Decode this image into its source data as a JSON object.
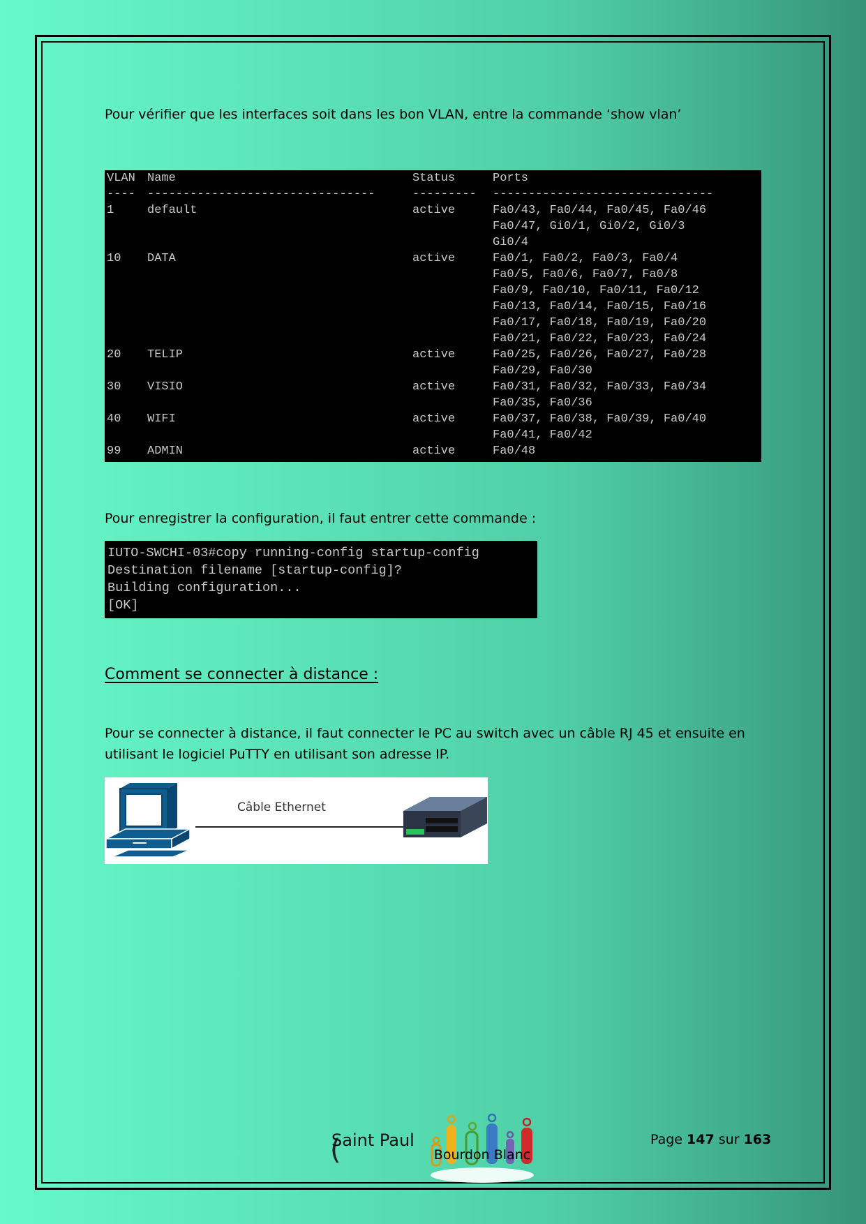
{
  "intro": "Pour vérifier que les interfaces soit dans les bon VLAN, entre la commande ‘show vlan’",
  "vlan_table": {
    "headers": {
      "id": "VLAN",
      "name": "Name",
      "status": "Status",
      "ports": "Ports"
    },
    "separator": {
      "id": "----",
      "name": "--------------------------------",
      "status": "---------",
      "ports": "-------------------------------"
    },
    "rows": [
      {
        "id": "1",
        "name": "default",
        "status": "active",
        "ports": [
          "Fa0/43, Fa0/44, Fa0/45, Fa0/46",
          "Fa0/47, Gi0/1, Gi0/2, Gi0/3",
          "Gi0/4"
        ]
      },
      {
        "id": "10",
        "name": "DATA",
        "status": "active",
        "ports": [
          "Fa0/1, Fa0/2, Fa0/3, Fa0/4",
          "Fa0/5, Fa0/6, Fa0/7, Fa0/8",
          "Fa0/9, Fa0/10, Fa0/11, Fa0/12",
          "Fa0/13, Fa0/14, Fa0/15, Fa0/16",
          "Fa0/17, Fa0/18, Fa0/19, Fa0/20",
          "Fa0/21, Fa0/22, Fa0/23, Fa0/24"
        ]
      },
      {
        "id": "20",
        "name": "TELIP",
        "status": "active",
        "ports": [
          "Fa0/25, Fa0/26, Fa0/27, Fa0/28",
          "Fa0/29, Fa0/30"
        ]
      },
      {
        "id": "30",
        "name": "VISIO",
        "status": "active",
        "ports": [
          "Fa0/31, Fa0/32, Fa0/33, Fa0/34",
          "Fa0/35, Fa0/36"
        ]
      },
      {
        "id": "40",
        "name": "WIFI",
        "status": "active",
        "ports": [
          "Fa0/37, Fa0/38, Fa0/39, Fa0/40",
          "Fa0/41, Fa0/42"
        ]
      },
      {
        "id": "99",
        "name": "ADMIN",
        "status": "active",
        "ports": [
          "Fa0/48"
        ]
      }
    ]
  },
  "save_text": "Pour enregistrer la configuration, il faut entrer cette commande :",
  "save_terminal": [
    "IUTO-SWCHI-03#copy running-config startup-config",
    "Destination filename [startup-config]?",
    "Building configuration...",
    "[OK]"
  ],
  "heading": "Comment se connecter à distance :",
  "remote_text_1": "Pour se connecter à distance, il faut connecter le PC au switch avec un câble RJ 45 et ensuite en",
  "remote_text_2": "utilisant le logiciel PuTTY en utilisant son adresse IP.",
  "diagram": {
    "cable_label": "Câble Ethernet"
  },
  "footer": {
    "school_part1": "Saint Paul",
    "school_part2": "Bourdon Blanc",
    "page_prefix": "Page",
    "page_current": "147",
    "page_sep": "sur",
    "page_total": "163"
  }
}
